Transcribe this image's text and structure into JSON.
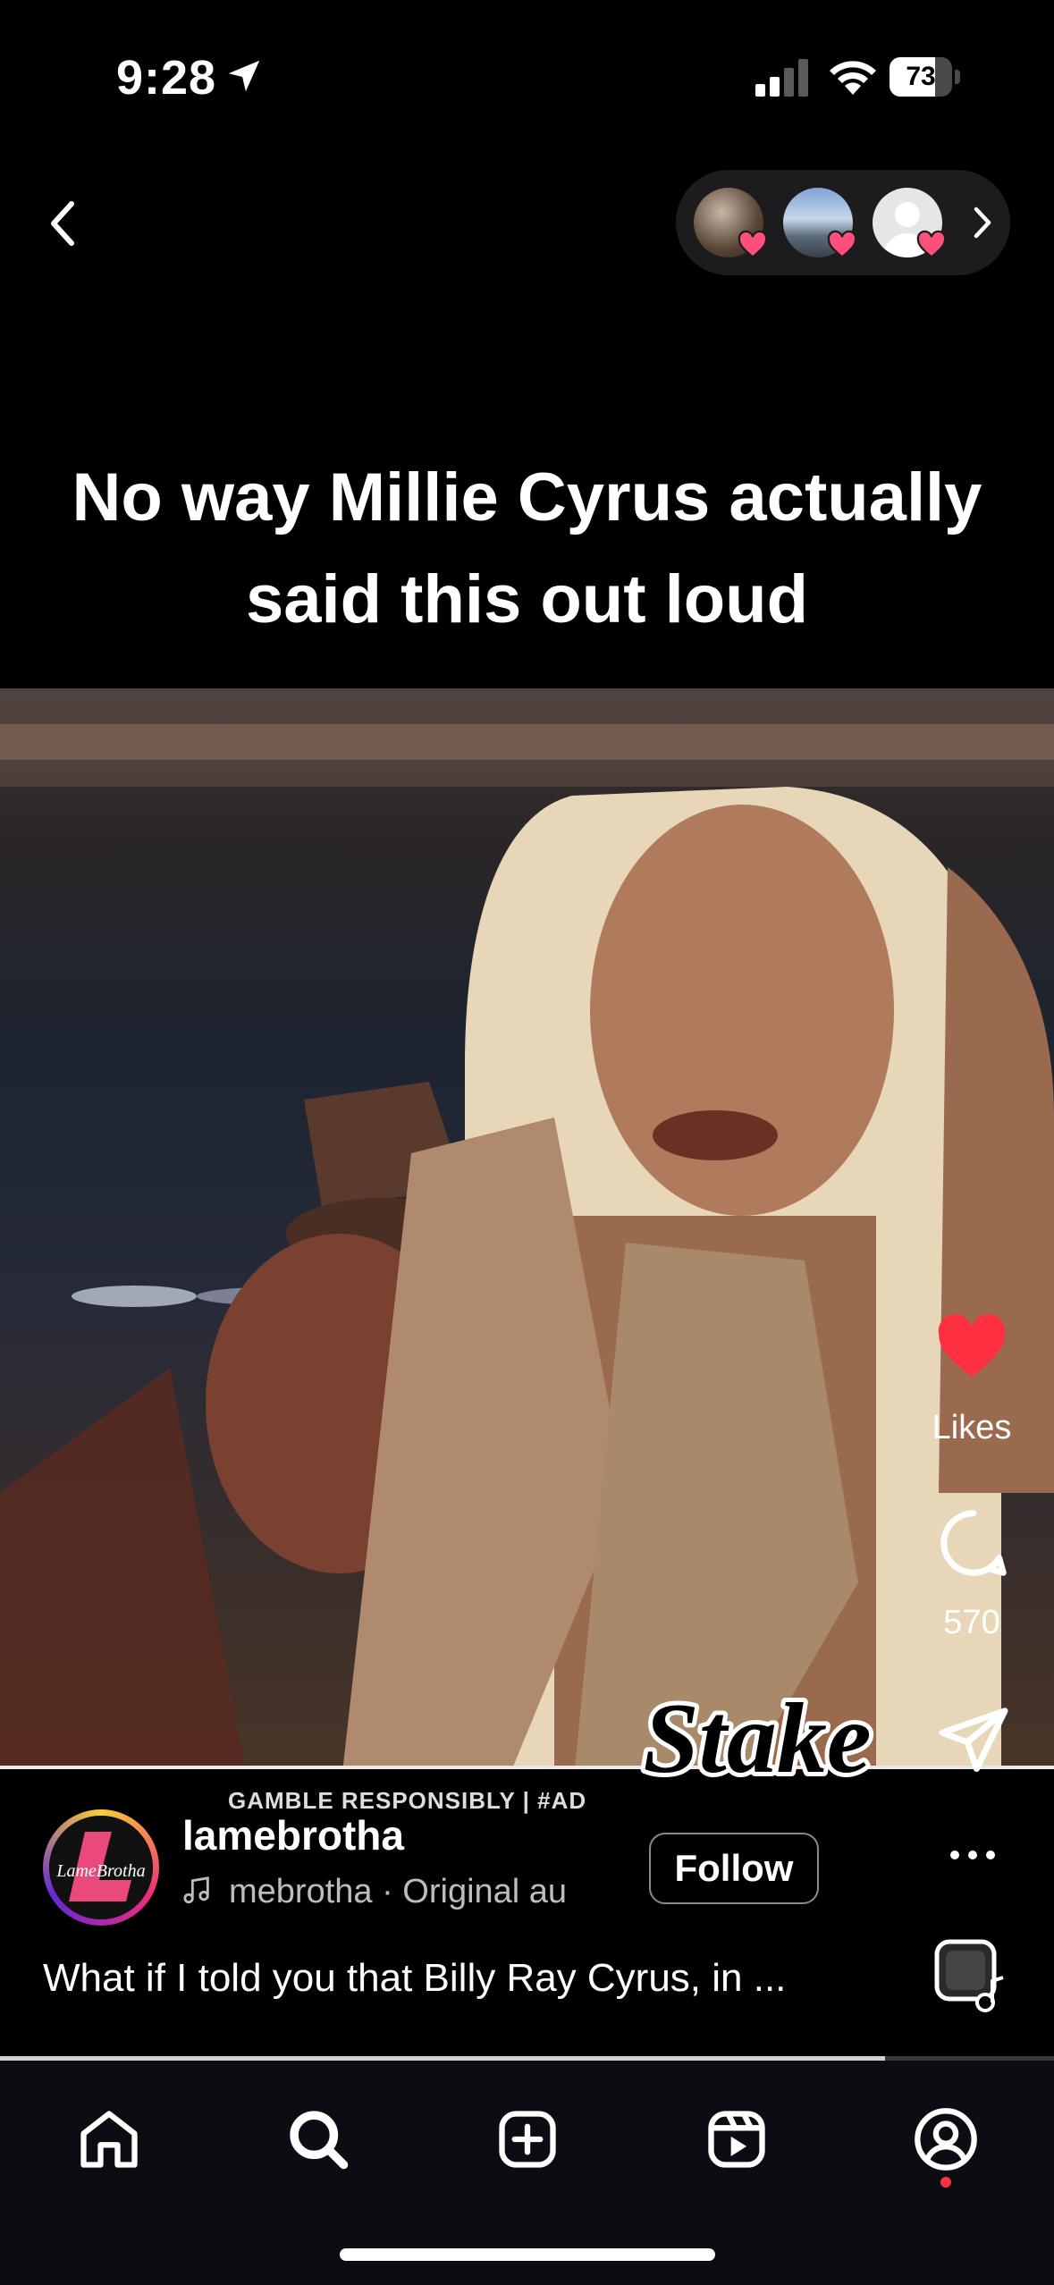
{
  "status_bar": {
    "time": "9:28",
    "battery_text": "73",
    "battery_level": 0.73,
    "icons": [
      "location-arrow-icon",
      "signal-icon",
      "wifi-icon",
      "battery-icon"
    ]
  },
  "nav": {
    "back_icon": "chevron-left-icon",
    "viewers_chevron_icon": "chevron-right-icon"
  },
  "post": {
    "headline": "No way Millie Cyrus actually said this out loud",
    "ad_label": "GAMBLE RESPONSIBLY  |  #AD",
    "overlay_logo": "Stake",
    "author": {
      "username": "lamebrotha",
      "avatar_text": "LameBrotha"
    },
    "audio": "mebrotha · Original au",
    "follow_label": "Follow",
    "caption": "What if I told you that Billy Ray Cyrus, in ...",
    "likes_label": "Likes",
    "comments_count": "570",
    "progress": 0.84
  },
  "tabs": [
    {
      "name": "home",
      "icon": "home-icon"
    },
    {
      "name": "search",
      "icon": "search-icon"
    },
    {
      "name": "create",
      "icon": "plus-square-icon"
    },
    {
      "name": "reels",
      "icon": "reels-icon"
    },
    {
      "name": "profile",
      "icon": "profile-icon"
    }
  ],
  "colors": {
    "background": "#000000",
    "like_red": "#ff3040",
    "tabbar": "#0c0c12"
  }
}
